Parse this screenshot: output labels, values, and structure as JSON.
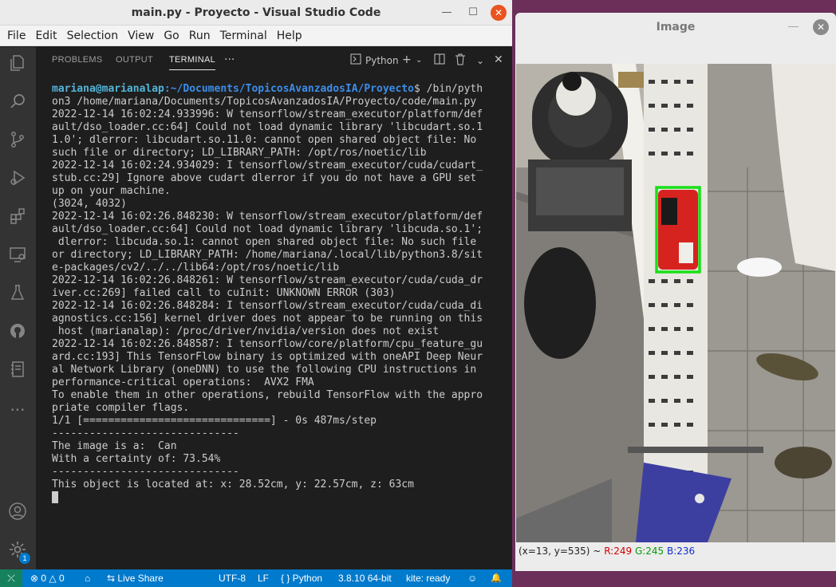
{
  "vscode": {
    "title": "main.py - Proyecto - Visual Studio Code",
    "window_controls": {
      "minimize": "—",
      "maximize": "☐",
      "close": "✕"
    },
    "menu": [
      "File",
      "Edit",
      "Selection",
      "View",
      "Go",
      "Run",
      "Terminal",
      "Help"
    ],
    "activity_icons": [
      "explorer-icon",
      "search-icon",
      "source-control-icon",
      "run-debug-icon",
      "extensions-icon",
      "remote-explorer-icon",
      "testing-icon",
      "github-icon",
      "notebook-icon",
      "more-icon",
      "account-icon",
      "settings-gear-icon"
    ],
    "settings_badge": "1",
    "panel": {
      "tabs": [
        "PROBLEMS",
        "OUTPUT",
        "TERMINAL"
      ],
      "active_tab": "TERMINAL",
      "more": "···",
      "terminal_profile": "Python"
    },
    "terminal": {
      "prompt_user": "mariana@marianalap",
      "prompt_path": ":~/Documents/TopicosAvanzadosIA/Proyecto",
      "prompt_command": "$ /bin/pyth",
      "lines": [
        "on3 /home/mariana/Documents/TopicosAvanzadosIA/Proyecto/code/main.py",
        "2022-12-14 16:02:24.933996: W tensorflow/stream_executor/platform/def",
        "ault/dso_loader.cc:64] Could not load dynamic library 'libcudart.so.1",
        "1.0'; dlerror: libcudart.so.11.0: cannot open shared object file: No",
        "such file or directory; LD_LIBRARY_PATH: /opt/ros/noetic/lib",
        "2022-12-14 16:02:24.934029: I tensorflow/stream_executor/cuda/cudart_",
        "stub.cc:29] Ignore above cudart dlerror if you do not have a GPU set",
        "up on your machine.",
        "(3024, 4032)",
        "2022-12-14 16:02:26.848230: W tensorflow/stream_executor/platform/def",
        "ault/dso_loader.cc:64] Could not load dynamic library 'libcuda.so.1';",
        " dlerror: libcuda.so.1: cannot open shared object file: No such file",
        "or directory; LD_LIBRARY_PATH: /home/mariana/.local/lib/python3.8/sit",
        "e-packages/cv2/../../lib64:/opt/ros/noetic/lib",
        "2022-12-14 16:02:26.848261: W tensorflow/stream_executor/cuda/cuda_dr",
        "iver.cc:269] failed call to cuInit: UNKNOWN ERROR (303)",
        "2022-12-14 16:02:26.848284: I tensorflow/stream_executor/cuda/cuda_di",
        "agnostics.cc:156] kernel driver does not appear to be running on this",
        " host (marianalap): /proc/driver/nvidia/version does not exist",
        "2022-12-14 16:02:26.848587: I tensorflow/core/platform/cpu_feature_gu",
        "ard.cc:193] This TensorFlow binary is optimized with oneAPI Deep Neur",
        "al Network Library (oneDNN) to use the following CPU instructions in",
        "performance-critical operations:  AVX2 FMA",
        "To enable them in other operations, rebuild TensorFlow with the appro",
        "priate compiler flags.",
        "1/1 [==============================] - 0s 487ms/step",
        "------------------------------",
        "The image is a:  Can",
        "With a certainty of: 73.54%",
        "------------------------------",
        "This object is located at: x: 28.52cm, y: 22.57cm, z: 63cm"
      ]
    },
    "statusbar": {
      "remote": "⤫",
      "problems": "⊗ 0 △ 0",
      "home": "⌂",
      "live_share": "⇆ Live Share",
      "encoding": "UTF-8",
      "eol": "LF",
      "language": "{ } Python",
      "interpreter": "3.8.10 64-bit",
      "kite": "kite: ready",
      "feedback": "☺",
      "notifications": "🔔"
    }
  },
  "image_window": {
    "title": "Image",
    "minimize": "—",
    "close": "✕",
    "detection_box_color": "#18e018",
    "pixel_info": {
      "coords": "(x=13, y=535) ~",
      "r": "R:249",
      "g": "G:245",
      "b": "B:236"
    }
  }
}
